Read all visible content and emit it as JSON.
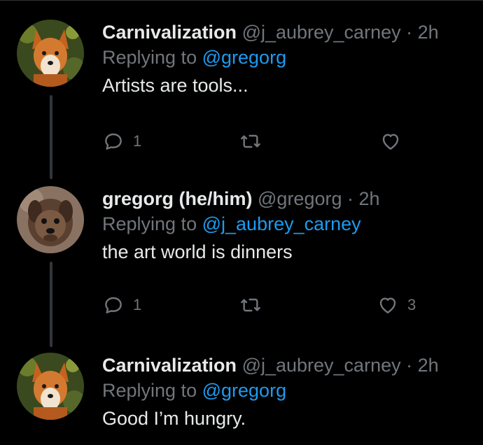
{
  "tweets": [
    {
      "name": "Carnivalization",
      "handle": "@j_aubrey_carney",
      "sep": "·",
      "time": "2h",
      "replying_prefix": "Replying to",
      "replying_to": "@gregorg",
      "text": "Artists are tools...",
      "reply_count": "1",
      "retweet_count": "",
      "like_count": "",
      "avatar_icon": "fox-avatar"
    },
    {
      "name": "gregorg (he/him)",
      "handle": "@gregorg",
      "sep": "·",
      "time": "2h",
      "replying_prefix": "Replying to",
      "replying_to": "@j_aubrey_carney",
      "text": "the art world is dinners",
      "reply_count": "1",
      "retweet_count": "",
      "like_count": "3",
      "avatar_icon": "dog-avatar"
    },
    {
      "name": "Carnivalization",
      "handle": "@j_aubrey_carney",
      "sep": "·",
      "time": "2h",
      "replying_prefix": "Replying to",
      "replying_to": "@gregorg",
      "text": "Good I’m hungry.",
      "avatar_icon": "fox-avatar"
    }
  ],
  "icons": {
    "reply": "reply-bubble-icon",
    "retweet": "retweet-icon",
    "like": "heart-icon"
  },
  "colors": {
    "background": "#000000",
    "text": "#e7e9ea",
    "muted": "#71767b",
    "link": "#1d9bf0",
    "thread_line": "#333639"
  }
}
